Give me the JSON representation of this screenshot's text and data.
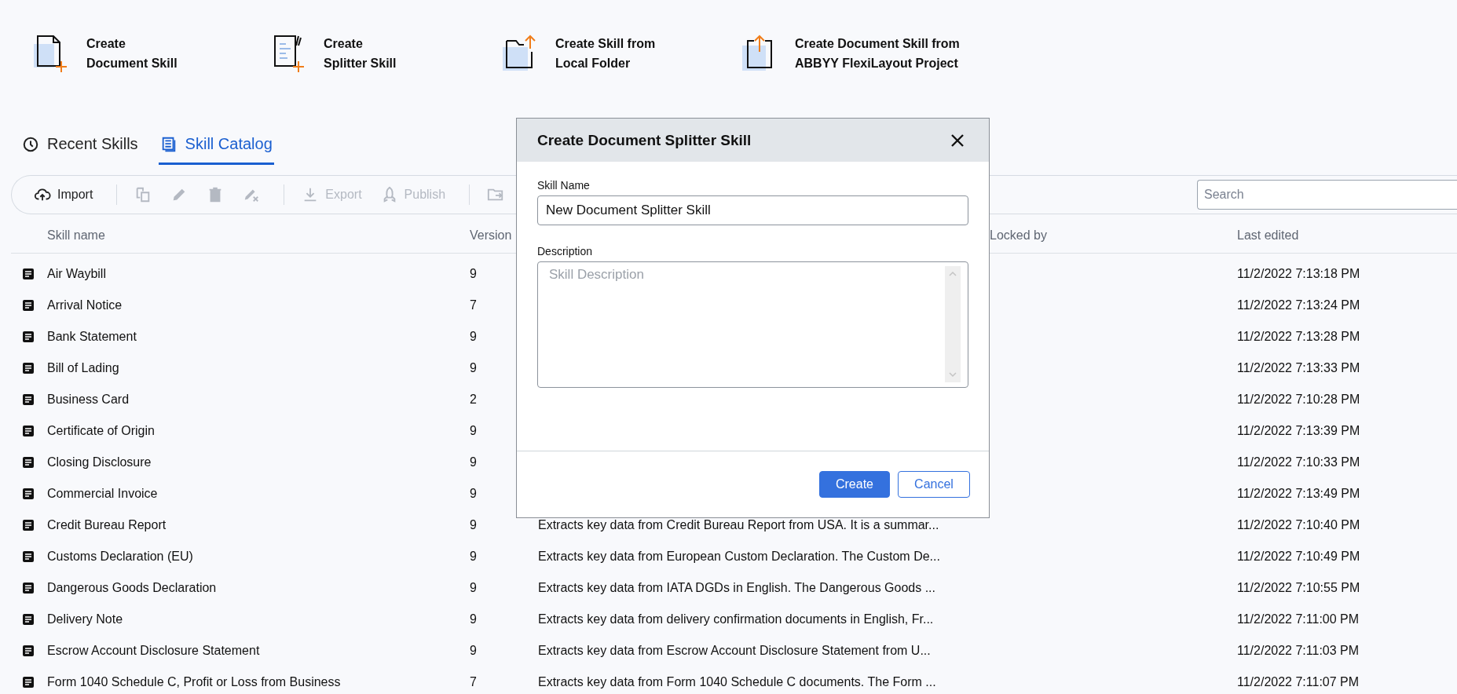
{
  "actions": [
    {
      "line1": "Create",
      "line2": "Document Skill"
    },
    {
      "line1": "Create",
      "line2": "Splitter Skill"
    },
    {
      "line1": "Create Skill from",
      "line2": "Local Folder"
    },
    {
      "line1": "Create Document Skill from",
      "line2": "ABBYY FlexiLayout Project"
    }
  ],
  "tabs": [
    {
      "label": "Recent Skills",
      "selected": false
    },
    {
      "label": "Skill Catalog",
      "selected": true
    }
  ],
  "toolbar": [
    {
      "kind": "button",
      "label": "Import",
      "disabled": false
    },
    {
      "kind": "separator"
    },
    {
      "kind": "icon",
      "disabled": true
    },
    {
      "kind": "icon",
      "disabled": true
    },
    {
      "kind": "icon",
      "disabled": true
    },
    {
      "kind": "icon",
      "disabled": true
    },
    {
      "kind": "separator"
    },
    {
      "kind": "button",
      "label": "Export",
      "disabled": true
    },
    {
      "kind": "button",
      "label": "Publish",
      "disabled": true
    },
    {
      "kind": "separator"
    },
    {
      "kind": "icon",
      "disabled": true
    }
  ],
  "search": {
    "placeholder": "Search"
  },
  "table": {
    "headers": {
      "name": "Skill name",
      "version": "Version",
      "locked": "Locked by",
      "edited": "Last edited"
    },
    "rows": [
      {
        "name": "Air Waybill",
        "version": "9",
        "edited": "11/2/2022 7:13:18 PM"
      },
      {
        "name": "Arrival Notice",
        "version": "7",
        "edited": "11/2/2022 7:13:24 PM"
      },
      {
        "name": "Bank Statement",
        "version": "9",
        "edited": "11/2/2022 7:13:28 PM"
      },
      {
        "name": "Bill of Lading",
        "version": "9",
        "edited": "11/2/2022 7:13:33 PM"
      },
      {
        "name": "Business Card",
        "version": "2",
        "edited": "11/2/2022 7:10:28 PM"
      },
      {
        "name": "Certificate of Origin",
        "version": "9",
        "edited": "11/2/2022 7:13:39 PM"
      },
      {
        "name": "Closing Disclosure",
        "version": "9",
        "edited": "11/2/2022 7:10:33 PM"
      },
      {
        "name": "Commercial Invoice",
        "version": "9",
        "edited": "11/2/2022 7:13:49 PM"
      },
      {
        "name": "Credit Bureau Report",
        "version": "9",
        "description": "Extracts key data from Credit Bureau Report from USA. It is a summar...",
        "edited": "11/2/2022 7:10:40 PM"
      },
      {
        "name": "Customs Declaration (EU)",
        "version": "9",
        "description": "Extracts key data from European Custom Declaration. The Custom De...",
        "edited": "11/2/2022 7:10:49 PM"
      },
      {
        "name": "Dangerous Goods Declaration",
        "version": "9",
        "description": "Extracts key data from IATA DGDs in English.  The Dangerous Goods ...",
        "edited": "11/2/2022 7:10:55 PM"
      },
      {
        "name": "Delivery Note",
        "version": "9",
        "description": "Extracts key data from delivery confirmation documents in English, Fr...",
        "edited": "11/2/2022 7:11:00 PM"
      },
      {
        "name": "Escrow Account Disclosure Statement",
        "version": "9",
        "description": "Extracts key data from Escrow Account Disclosure Statement from U...",
        "edited": "11/2/2022 7:11:03 PM"
      },
      {
        "name": "Form 1040 Schedule C, Profit or Loss from Business",
        "version": "7",
        "description": "Extracts key data from Form 1040 Schedule C documents. The Form ...",
        "edited": "11/2/2022 7:11:07 PM"
      }
    ]
  },
  "dialog": {
    "title": "Create Document Splitter Skill",
    "name_field": {
      "label": "Skill Name",
      "value": "New Document Splitter Skill"
    },
    "description_field": {
      "label": "Description",
      "placeholder": "Skill Description"
    },
    "buttons": [
      {
        "kind": "primary",
        "label": "Create"
      },
      {
        "kind": "secondary",
        "label": "Cancel"
      }
    ]
  }
}
